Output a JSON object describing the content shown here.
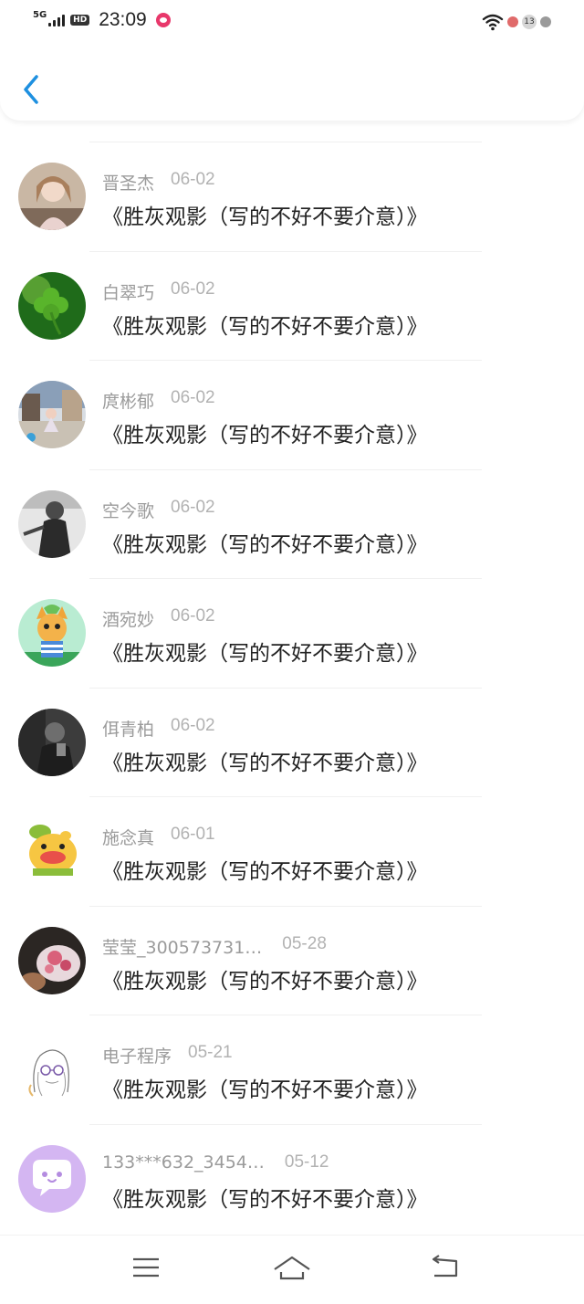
{
  "status_bar": {
    "network": "5G",
    "hd": "HD",
    "time": "23:09",
    "notification_count": "13"
  },
  "header": {
    "back_icon": "chevron-left-icon"
  },
  "list": {
    "items": [
      {
        "name": "晋圣杰",
        "date": "06-02",
        "title": "《胜灰观影（写的不好不要介意）》",
        "avatar": "photo-girl-avatar"
      },
      {
        "name": "白翠巧",
        "date": "06-02",
        "title": "《胜灰观影（写的不好不要介意）》",
        "avatar": "clover-avatar"
      },
      {
        "name": "庹彬郁",
        "date": "06-02",
        "title": "《胜灰观影（写的不好不要介意）》",
        "avatar": "street-photo-avatar"
      },
      {
        "name": "空今歌",
        "date": "06-02",
        "title": "《胜灰观影（写的不好不要介意）》",
        "avatar": "bw-person-avatar"
      },
      {
        "name": "酒宛妙",
        "date": "06-02",
        "title": "《胜灰观影（写的不好不要介意）》",
        "avatar": "cartoon-cat-avatar"
      },
      {
        "name": "佴青柏",
        "date": "06-02",
        "title": "《胜灰观影（写的不好不要介意）》",
        "avatar": "dark-photo-avatar"
      },
      {
        "name": "施念真",
        "date": "06-01",
        "title": "《胜灰观影（写的不好不要介意）》",
        "avatar": "yellow-cartoon-avatar"
      },
      {
        "name": "莹莹_300573731…",
        "date": "05-28",
        "title": "《胜灰观影（写的不好不要介意）》",
        "avatar": "food-photo-avatar"
      },
      {
        "name": "电子程序",
        "date": "05-21",
        "title": "《胜灰观影（写的不好不要介意）》",
        "avatar": "sketch-girl-avatar"
      },
      {
        "name": "133***632_3454…",
        "date": "05-12",
        "title": "《胜灰观影（写的不好不要介意）》",
        "avatar": "default-chat-avatar"
      }
    ]
  },
  "bottom_nav": {
    "menu_icon": "menu-icon",
    "home_icon": "home-icon",
    "back_icon": "back-icon"
  }
}
